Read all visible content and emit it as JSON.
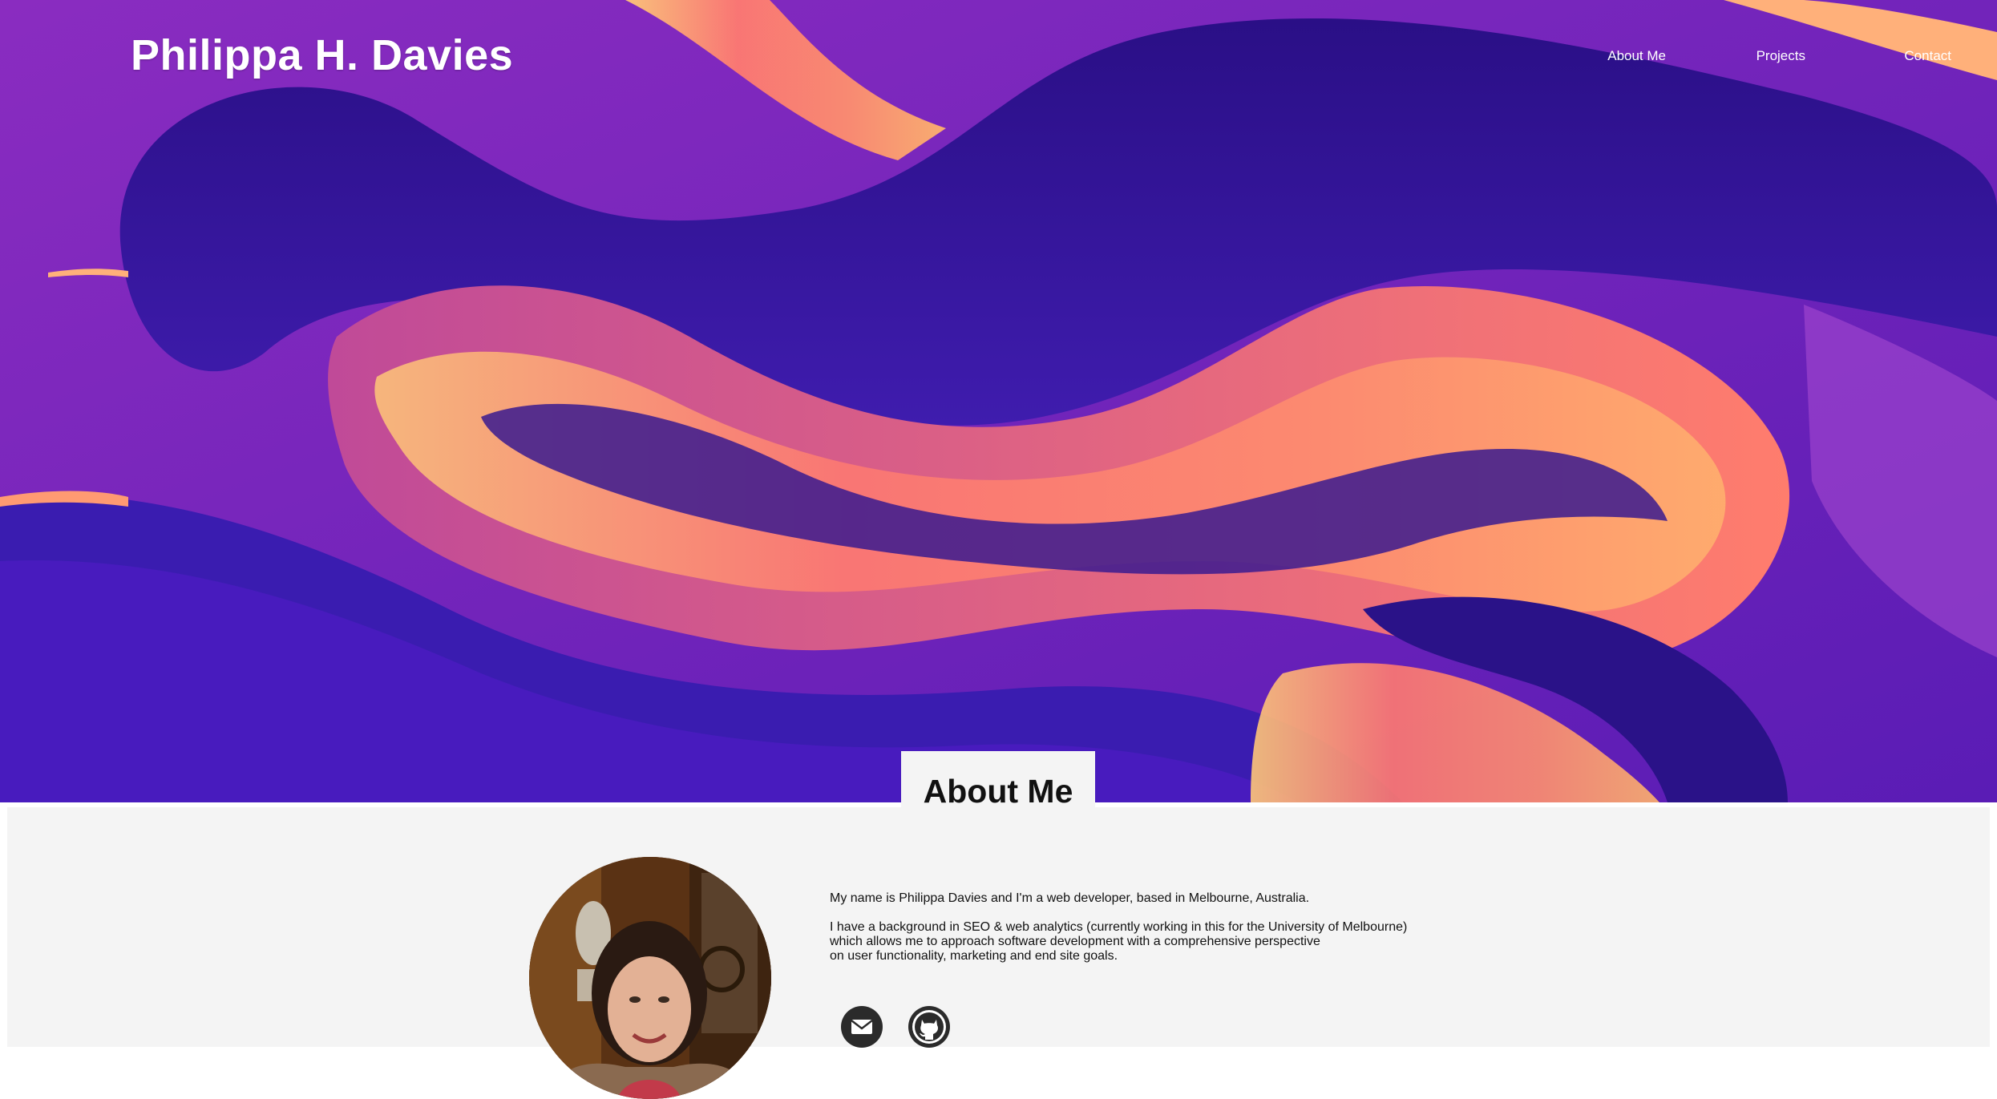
{
  "header": {
    "site_title": "Philippa H. Davies",
    "nav": [
      {
        "label": "About Me"
      },
      {
        "label": "Projects"
      },
      {
        "label": "Contact"
      }
    ]
  },
  "about": {
    "heading": "About Me",
    "paragraph_1": "My name is Philippa Davies and I'm a web developer, based in Melbourne, Australia.",
    "paragraph_2_lines": [
      "I have a background in SEO & web analytics (currently working in this for the University of Melbourne)",
      "which allows me to approach software development with a comprehensive perspective",
      "on user functionality, marketing and end site goals."
    ],
    "social_icons": [
      "mail-icon",
      "github-icon"
    ]
  },
  "colors": {
    "hero_primary": "#3b1aa8",
    "hero_accent_orange": "#ff8a6b",
    "section_background": "#f4f4f4",
    "icon_circle": "#2b2b2b"
  }
}
